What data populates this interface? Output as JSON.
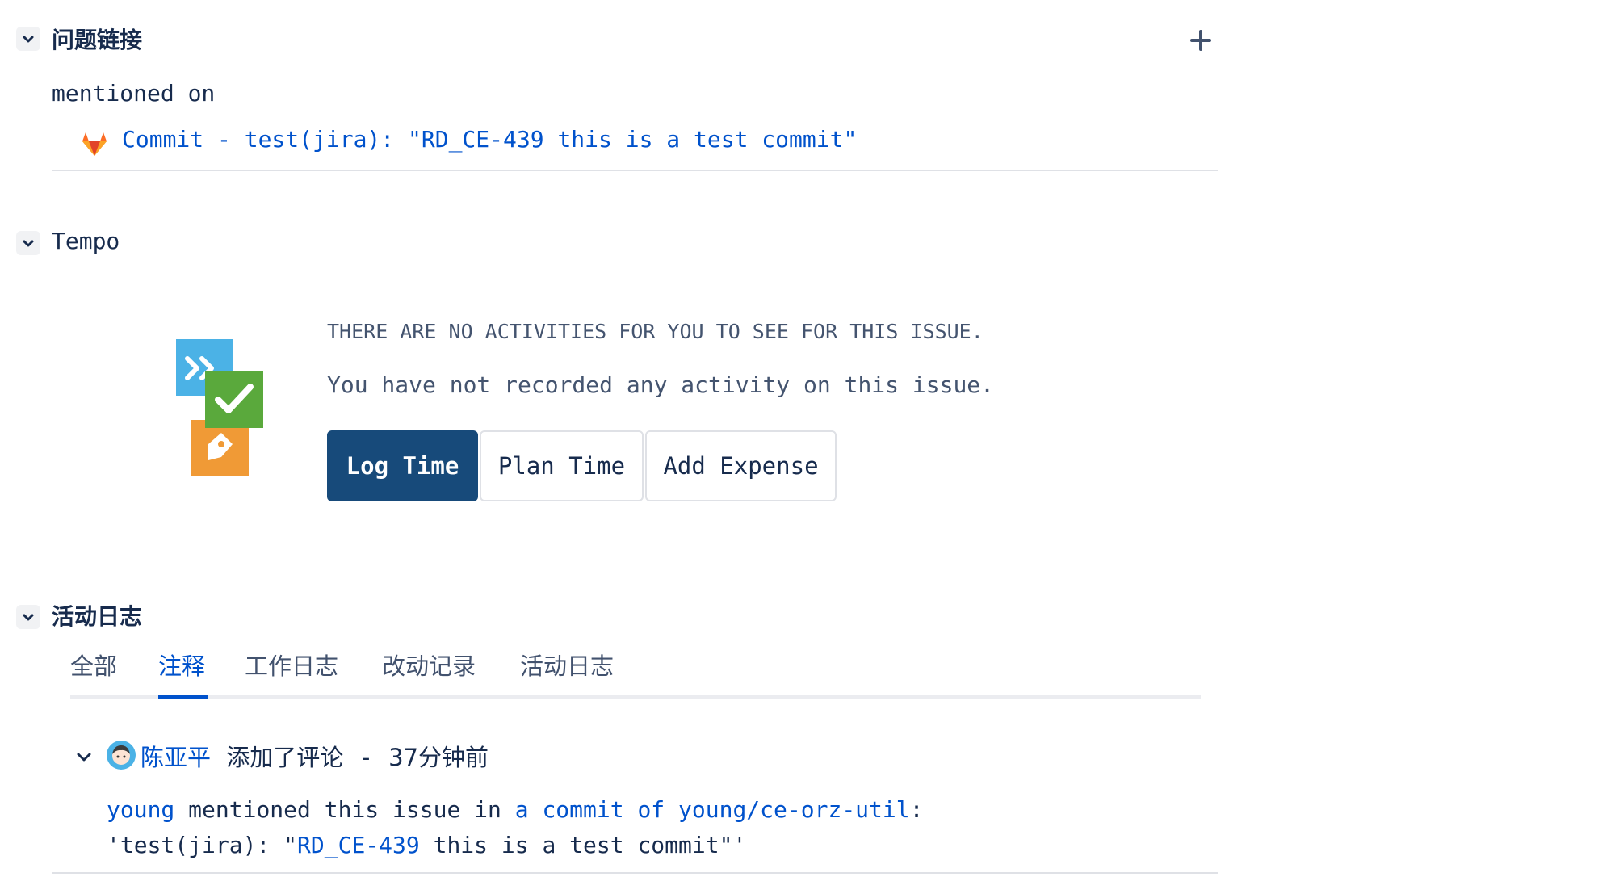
{
  "issue_links": {
    "title": "问题链接",
    "mentioned_label": "mentioned on",
    "commit_link": "Commit - test(jira): \"RD_CE-439 this is a test commit\""
  },
  "tempo": {
    "title": "Tempo",
    "empty_heading": "THERE ARE NO ACTIVITIES FOR YOU TO SEE FOR THIS ISSUE.",
    "empty_message": "You have not recorded any activity on this issue.",
    "buttons": {
      "log_time": "Log Time",
      "plan_time": "Plan Time",
      "add_expense": "Add Expense"
    }
  },
  "activity": {
    "title": "活动日志",
    "tabs": [
      "全部",
      "注释",
      "工作日志",
      "改动记录",
      "活动日志"
    ],
    "active_tab": "注释",
    "comment": {
      "author": "陈亚平",
      "action": "添加了评论",
      "separator": "-",
      "time": "37分钟前",
      "line1": {
        "user": "young",
        "text1": " mentioned this issue in ",
        "link": "a commit of young/ce-orz-util",
        "text2": ":"
      },
      "line2": {
        "prefix": "'test(jira): \"",
        "issue_key": "RD_CE-439",
        "suffix": " this is a test commit\"'"
      }
    }
  },
  "colors": {
    "link": "#0052cc",
    "primary_button": "#174a7a",
    "tempo_blue": "#4bb2e6",
    "tempo_green": "#5aa93c",
    "tempo_orange": "#f09a36",
    "gitlab_orange": "#e24329"
  },
  "icons": [
    "chevron-down-icon",
    "plus-icon",
    "gitlab-icon",
    "tempo-logo-icon",
    "avatar-icon"
  ]
}
